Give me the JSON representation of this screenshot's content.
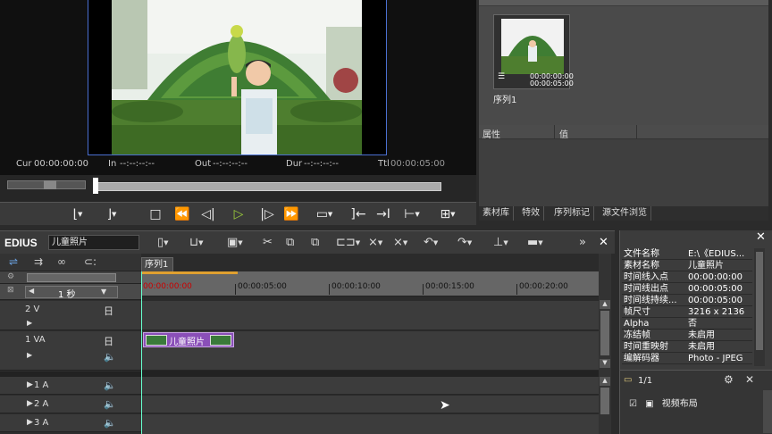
{
  "player": {
    "cur_label": "Cur",
    "cur_value": "00:00:00:00",
    "in_label": "In",
    "in_value": "--:--:--:--",
    "out_label": "Out",
    "out_value": "--:--:--:--",
    "dur_label": "Dur",
    "dur_value": "--:--:--:--",
    "ttl_label": "Ttl",
    "ttl_value": "00:00:05:00"
  },
  "bin": {
    "thumb_tc_top": "00:00:00:00",
    "thumb_tc_bottom": "00:00:05:00",
    "sequence_label": "序列1"
  },
  "properties_mini": {
    "col_attribute": "属性",
    "col_value": "值",
    "tabs": [
      "素材库",
      "特效",
      "序列标记",
      "源文件浏览"
    ]
  },
  "timeline": {
    "logo": "EDIUS",
    "project_name": "儿童照片",
    "sequence_tab": "序列1",
    "scale_label": "1 秒",
    "ruler_ticks": [
      "00:00:00:00",
      "00:00:05:00",
      "00:00:10:00",
      "00:00:15:00",
      "00:00:20:00"
    ],
    "tracks": [
      {
        "name": "2 V"
      },
      {
        "name": "1 VA"
      },
      {
        "name": "1 A"
      },
      {
        "name": "2 A"
      },
      {
        "name": "3 A"
      }
    ],
    "clip_label": "儿童照片"
  },
  "info_panel": {
    "rows": [
      {
        "key": "文件名称",
        "value": "E:\\《EDIUS..."
      },
      {
        "key": "素材名称",
        "value": "儿童照片"
      },
      {
        "key": "时间线入点",
        "value": "00:00:00:00"
      },
      {
        "key": "时间线出点",
        "value": "00:00:05:00"
      },
      {
        "key": "时间线持续...",
        "value": "00:00:05:00"
      },
      {
        "key": "帧尺寸",
        "value": "3216 x 2136"
      },
      {
        "key": "Alpha",
        "value": "否"
      },
      {
        "key": "冻结帧",
        "value": "未启用"
      },
      {
        "key": "时间重映射",
        "value": "未启用"
      },
      {
        "key": "编解码器",
        "value": "Photo - JPEG"
      }
    ],
    "page_label": "1/1",
    "effect_item": "视频布局"
  },
  "colors": {
    "accent_border": "#4a6fd0",
    "clip_purple": "#8a4fb8",
    "play_green": "#9ed23a"
  }
}
